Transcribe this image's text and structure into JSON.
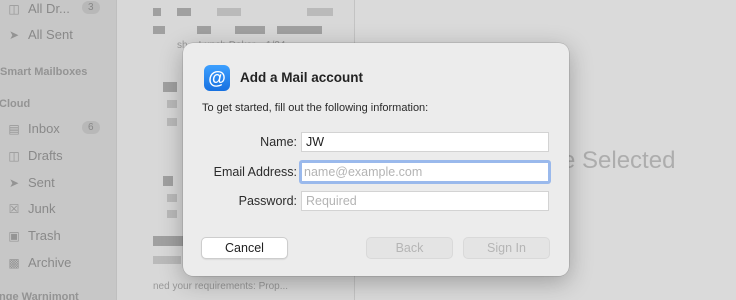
{
  "sidebar": {
    "items_top": [
      {
        "label": "All Dr...",
        "icon": "drafts-icon",
        "badge": "3"
      },
      {
        "label": "All Sent",
        "icon": "sent-icon"
      }
    ],
    "section_smart": "Smart Mailboxes",
    "section_cloud": "iCloud",
    "items_cloud": [
      {
        "label": "Inbox",
        "icon": "inbox-icon",
        "badge": "6"
      },
      {
        "label": "Drafts",
        "icon": "drafts-icon"
      },
      {
        "label": "Sent",
        "icon": "sent-icon"
      },
      {
        "label": "Junk",
        "icon": "junk-icon"
      },
      {
        "label": "Trash",
        "icon": "trash-icon"
      },
      {
        "label": "Archive",
        "icon": "archive-icon"
      }
    ],
    "bottom_account": "Inge Warnimont"
  },
  "message_list": {
    "snippet_1": "sh... Lunch Dakar... 1/24",
    "snippet_2": "ned your requirements: Prop..."
  },
  "content": {
    "placeholder_partial": "e Selected"
  },
  "dialog": {
    "icon": "at-sign-icon",
    "icon_glyph": "@",
    "title": "Add a Mail account",
    "intro": "To get started, fill out the following information:",
    "name_label": "Name:",
    "name_value": "JW",
    "email_label": "Email Address:",
    "email_placeholder": "name@example.com",
    "password_label": "Password:",
    "password_placeholder": "Required",
    "cancel_label": "Cancel",
    "back_label": "Back",
    "signin_label": "Sign In"
  }
}
